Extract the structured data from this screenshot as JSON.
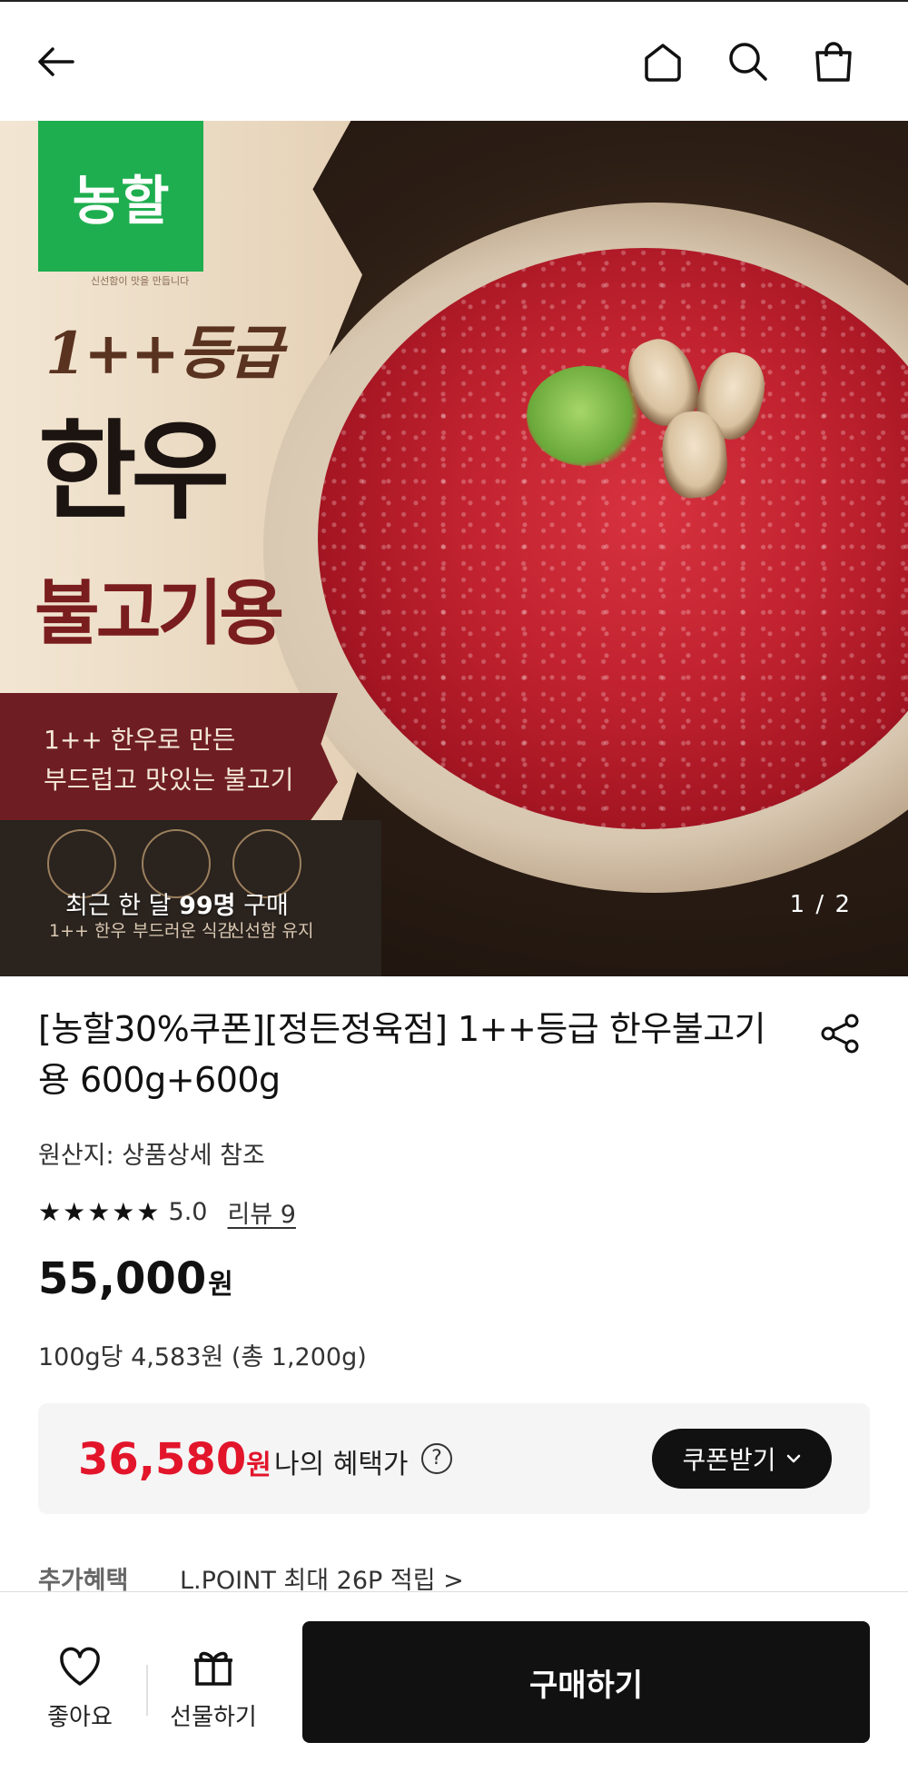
{
  "header": {
    "back_icon": "arrow-left-icon",
    "home_icon": "home-icon",
    "search_icon": "search-icon",
    "cart_icon": "shopping-bag-icon"
  },
  "hero": {
    "logo_text": "농할",
    "logo_sub": "신선함이 맛을 만듭니다",
    "grade_text": "1++등급",
    "main_text": "한우",
    "sub_text": "불고기용",
    "band_line1": "1++ 한우로 만든",
    "band_line2": "부드럽고 맛있는 불고기",
    "features": [
      "1++ 한우",
      "부드러운 식감",
      "신선함 유지"
    ],
    "recent_prefix": "최근 한 달 ",
    "recent_count": "99명",
    "recent_suffix": " 구매",
    "pager": "1 / 2"
  },
  "product": {
    "title": "[농할30%쿠폰][정든정육점] 1++등급 한우불고기용 600g+600g",
    "origin": "원산지: 상품상세 참조",
    "stars": "★★★★★",
    "score": "5.0",
    "review": "리뷰 9",
    "price": "55,000",
    "price_unit": "원",
    "unit_price": "100g당 4,583원 (총 1,200g)"
  },
  "benefit": {
    "price": "36,580",
    "price_unit": "원",
    "label": "나의 혜택가",
    "help": "?",
    "coupon_label": "쿠폰받기",
    "accent": "#e2152b"
  },
  "extra": {
    "label": "추가혜택",
    "value": "L.POINT 최대 26P 적립 >"
  },
  "bottom": {
    "like_label": "좋아요",
    "gift_label": "선물하기",
    "buy_label": "구매하기"
  }
}
